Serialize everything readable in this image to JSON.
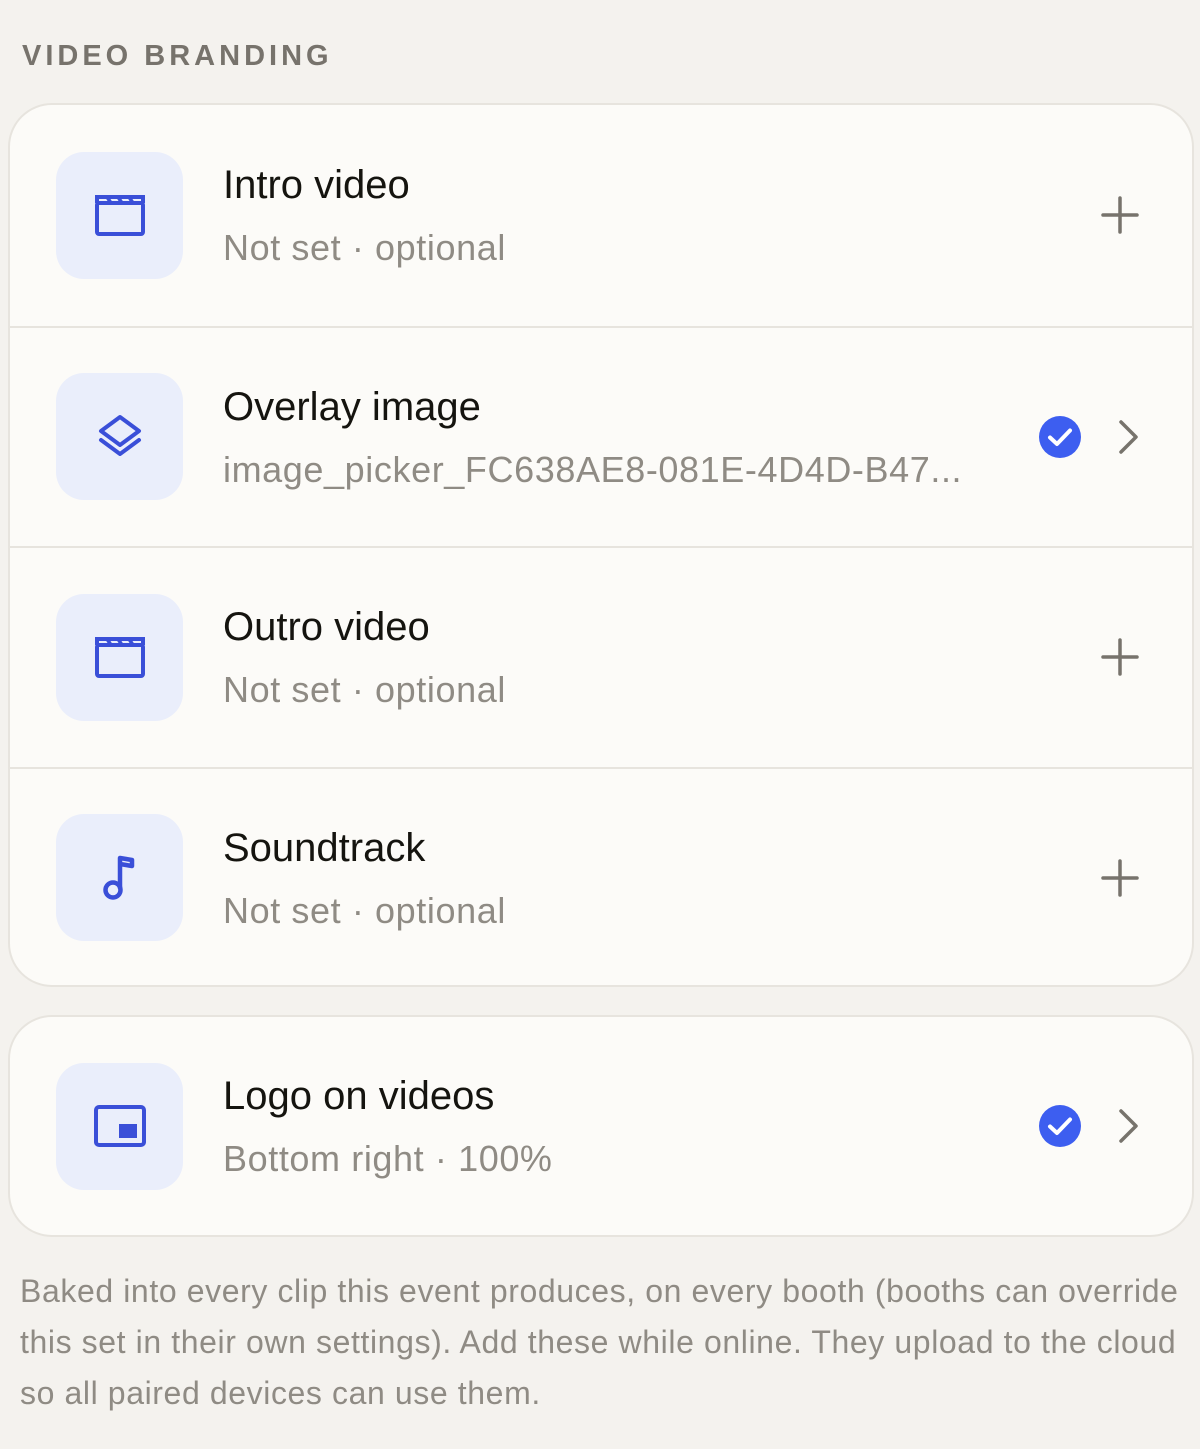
{
  "section": {
    "title": "VIDEO BRANDING"
  },
  "colors": {
    "accent": "#3a4fd8",
    "tile_bg": "#eaeefb",
    "check": "#3d5ef0"
  },
  "media_rows": [
    {
      "icon": "clapperboard-icon",
      "title": "Intro video",
      "subtitle": "Not set · optional",
      "action": "plus"
    },
    {
      "icon": "layers-icon",
      "title": "Overlay image",
      "subtitle": "image_picker_FC638AE8-081E-4D4D-B47...",
      "action": "check-chevron"
    },
    {
      "icon": "clapperboard-icon",
      "title": "Outro video",
      "subtitle": "Not set · optional",
      "action": "plus"
    },
    {
      "icon": "music-note-icon",
      "title": "Soundtrack",
      "subtitle": "Not set · optional",
      "action": "plus"
    }
  ],
  "logo_row": {
    "icon": "picture-in-picture-icon",
    "title": "Logo on videos",
    "subtitle": "Bottom right · 100%",
    "action": "check-chevron"
  },
  "footnote": "Baked into every clip this event produces, on every booth (booths can override this set in their own settings). Add these while online. They upload to the cloud so all paired devices can use them."
}
